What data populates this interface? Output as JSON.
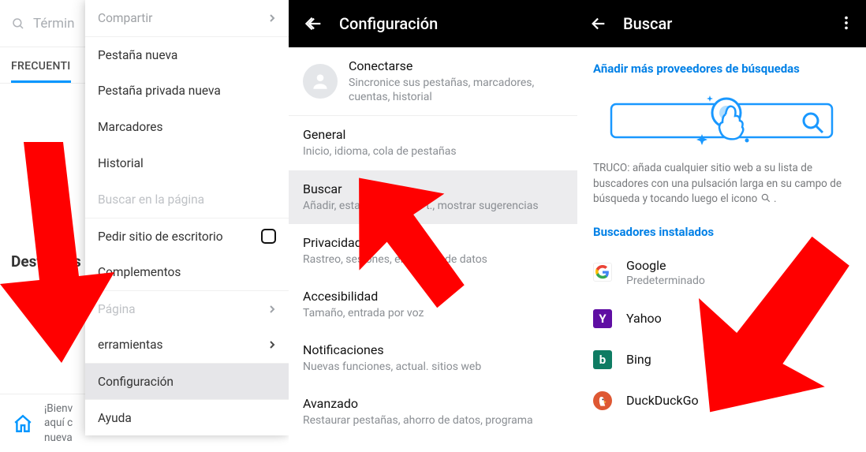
{
  "panel1": {
    "search_placeholder": "Términ",
    "tab_frequent": "FRECUENTI",
    "destacados_label": "Destac",
    "bottom_text_line1": "¡Bienv",
    "bottom_text_line2": "aquí c",
    "bottom_text_line3": "nueva",
    "menu": [
      {
        "label": "Compartir",
        "kind": "disabled-chevron"
      },
      {
        "label": "Pestaña nueva"
      },
      {
        "label": "Pestaña privada nueva"
      },
      {
        "label": "Marcadores"
      },
      {
        "label": "Historial"
      },
      {
        "label": "Buscar en la página",
        "kind": "disabled"
      },
      {
        "label": "Pedir sitio de escritorio",
        "kind": "checkbox"
      },
      {
        "label": "Complementos"
      },
      {
        "label": "Página",
        "kind": "disabled-chevron-sep"
      },
      {
        "label": "erramientas",
        "kind": "chevron"
      },
      {
        "label": "Configuración",
        "kind": "selected"
      },
      {
        "label": "Ayuda",
        "kind": "sep"
      }
    ]
  },
  "panel2": {
    "title": "Configuración",
    "rows": [
      {
        "hdr": "Conectarse",
        "sub": "Sincronice sus pestañas, marcadores, cuentas, historial",
        "avatar": true
      },
      {
        "hdr": "General",
        "sub": "Inicio, idioma, cola de pestañas"
      },
      {
        "hdr": "Buscar",
        "sub": "Añadir, esta                        t., mostrar sugerencias",
        "selected": true
      },
      {
        "hdr": "Privacidad",
        "sub": "Rastreo, sesiones, elec           de datos"
      },
      {
        "hdr": "Accesibilidad",
        "sub": "Tamaño, entrada por voz"
      },
      {
        "hdr": "Notificaciones",
        "sub": "Nuevas funciones, actual. sitios web"
      },
      {
        "hdr": "Avanzado",
        "sub": "Restaurar pestañas, ahorro de datos, programa"
      }
    ]
  },
  "panel3": {
    "title": "Buscar",
    "add_providers": "Añadir más proveedores de búsquedas",
    "tip_prefix": "TRUCO: ",
    "tip_body": "añada cualquier sitio web a su lista de buscadores con una pulsación larga en su campo de búsqueda y tocando luego el icono",
    "installed_label": "Buscadores instalados",
    "engines": [
      {
        "name": "Google",
        "sub": "Predeterminado",
        "icon": "google"
      },
      {
        "name": "Yahoo",
        "icon": "yahoo"
      },
      {
        "name": "Bing",
        "icon": "bing"
      },
      {
        "name": "DuckDuckGo",
        "icon": "ddg"
      }
    ]
  },
  "arrow_color": "#ff0000"
}
